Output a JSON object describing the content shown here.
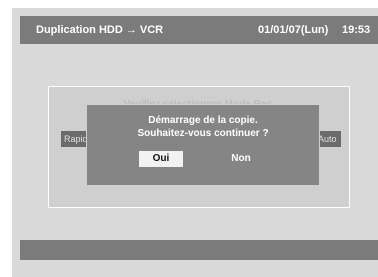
{
  "header": {
    "title": "Duplication HDD → VCR",
    "date": "01/01/07(Lun)",
    "time": "19:53"
  },
  "background_panel": {
    "title": "Veuillez sélectionner Mode Rec.",
    "left_option": "Rapide",
    "right_option": "Auto"
  },
  "dialog": {
    "line1": "Démarrage de la copie.",
    "line2": "Souhaitez-vous continuer ?",
    "yes_label": "Oui",
    "no_label": "Non",
    "selected": "Oui"
  }
}
